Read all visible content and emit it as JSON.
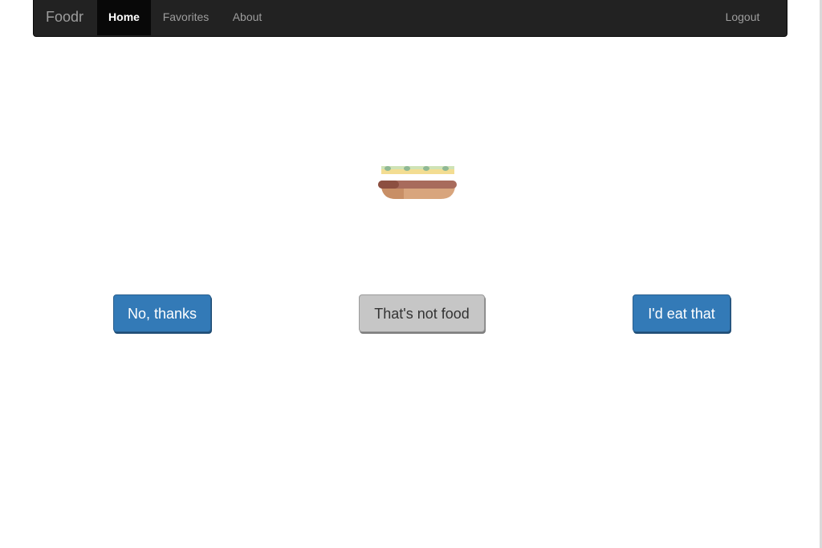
{
  "navbar": {
    "brand": "Foodr",
    "items": [
      {
        "label": "Home",
        "active": true
      },
      {
        "label": "Favorites",
        "active": false
      },
      {
        "label": "About",
        "active": false
      }
    ],
    "logout_label": "Logout"
  },
  "main": {
    "food_image": "sandwich-illustration",
    "buttons": {
      "reject_label": "No, thanks",
      "not_food_label": "That's not food",
      "accept_label": "I'd eat that"
    }
  },
  "colors": {
    "navbar_bg": "#222222",
    "primary": "#337ab7",
    "neutral": "#c6c6c6"
  }
}
